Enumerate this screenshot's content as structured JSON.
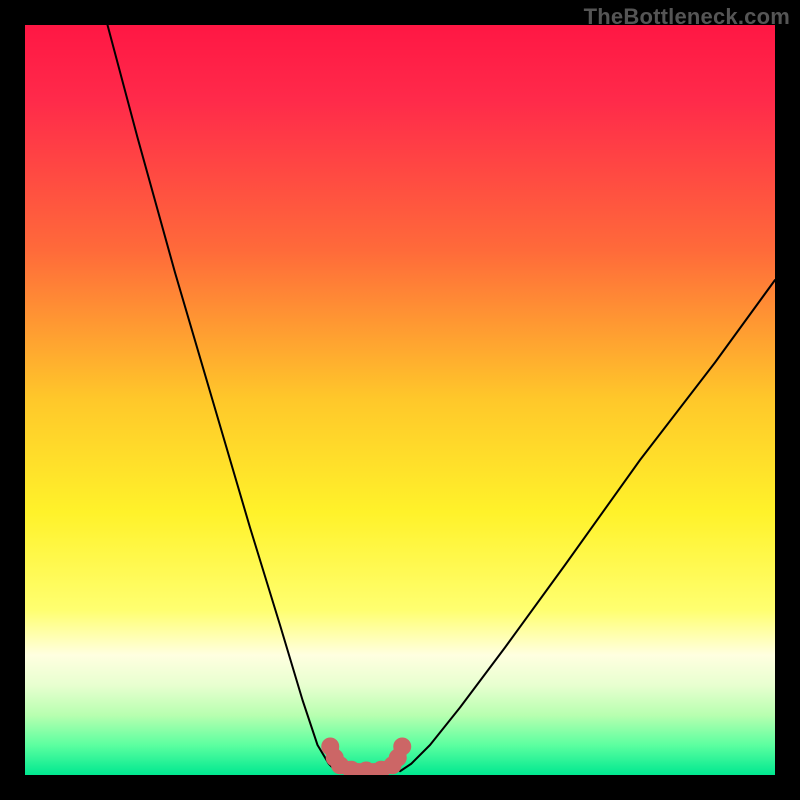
{
  "watermark": "TheBottleneck.com",
  "chart_data": {
    "type": "line",
    "title": "",
    "xlabel": "",
    "ylabel": "",
    "xlim": [
      0,
      100
    ],
    "ylim": [
      0,
      100
    ],
    "gradient": {
      "stops": [
        {
          "offset": 0.0,
          "color": "#ff1744"
        },
        {
          "offset": 0.1,
          "color": "#ff2a4a"
        },
        {
          "offset": 0.3,
          "color": "#ff6a3a"
        },
        {
          "offset": 0.5,
          "color": "#ffc82a"
        },
        {
          "offset": 0.65,
          "color": "#fff22a"
        },
        {
          "offset": 0.78,
          "color": "#ffff70"
        },
        {
          "offset": 0.84,
          "color": "#ffffe0"
        },
        {
          "offset": 0.88,
          "color": "#e8ffd0"
        },
        {
          "offset": 0.92,
          "color": "#b8ffb0"
        },
        {
          "offset": 0.96,
          "color": "#5cffa0"
        },
        {
          "offset": 1.0,
          "color": "#00e890"
        }
      ]
    },
    "series": [
      {
        "name": "left-branch",
        "x": [
          11,
          15,
          20,
          25,
          30,
          34,
          37,
          39,
          40.5,
          41.5
        ],
        "y": [
          100,
          85,
          67,
          50,
          33,
          20,
          10,
          4,
          1.5,
          0.5
        ],
        "stroke": "#000000",
        "width": 2
      },
      {
        "name": "right-branch",
        "x": [
          50,
          51.5,
          54,
          58,
          64,
          72,
          82,
          92,
          100
        ],
        "y": [
          0.5,
          1.5,
          4,
          9,
          17,
          28,
          42,
          55,
          66
        ],
        "stroke": "#000000",
        "width": 2
      },
      {
        "name": "bottom-highlight",
        "x": [
          40.7,
          41.3,
          42.0,
          43.5,
          45.5,
          47.5,
          49.0,
          49.7,
          50.3
        ],
        "y": [
          3.8,
          2.3,
          1.3,
          0.7,
          0.6,
          0.7,
          1.3,
          2.3,
          3.8
        ],
        "stroke": "#cc6666",
        "width": 14
      }
    ],
    "markers": {
      "name": "bottom-dots",
      "x": [
        40.7,
        41.3,
        42.0,
        43.5,
        45.5,
        47.5,
        49.0,
        49.7,
        50.3
      ],
      "y": [
        3.8,
        2.3,
        1.3,
        0.7,
        0.6,
        0.7,
        1.3,
        2.3,
        3.8
      ],
      "r": 9,
      "fill": "#cc6666"
    }
  }
}
